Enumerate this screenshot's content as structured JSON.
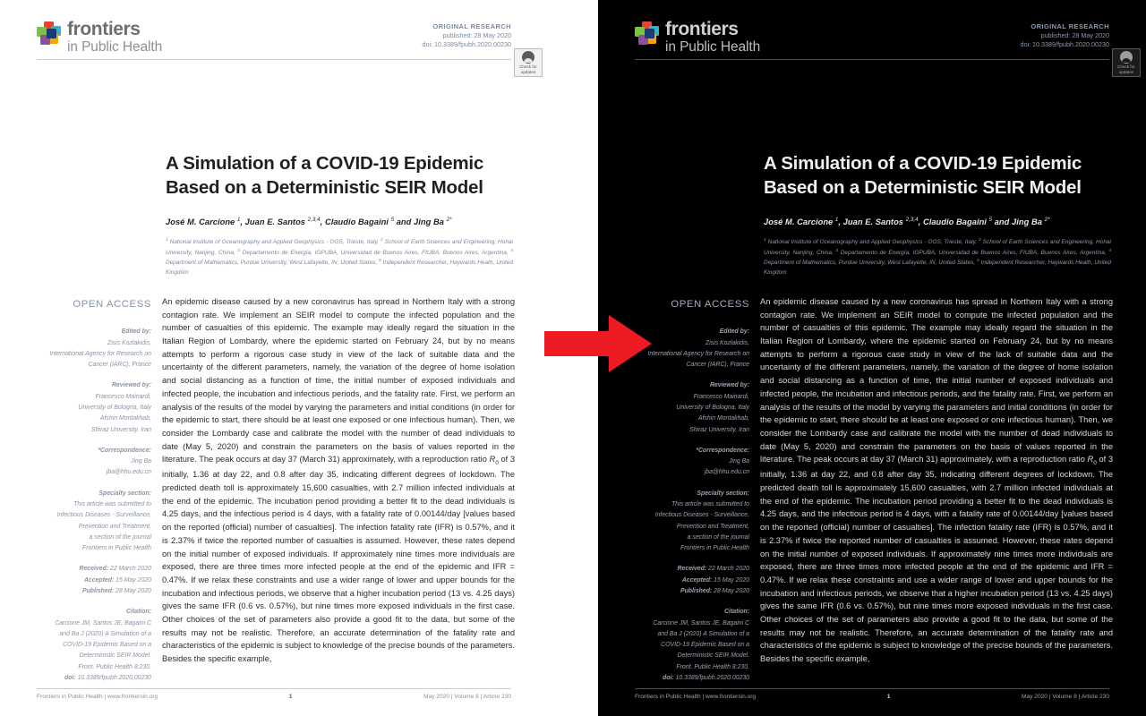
{
  "journal": {
    "logo_word": "frontiers",
    "logo_sub": "in Public Health",
    "logo_icon": "frontiers-pinwheel-logo"
  },
  "publication": {
    "type": "ORIGINAL RESEARCH",
    "published": "published: 28 May 2020",
    "doi": "doi: 10.3389/fpubh.2020.00230"
  },
  "crossmark": {
    "line1": "Check for",
    "line2": "updates",
    "icon": "check-for-updates-icon"
  },
  "paper": {
    "title_line1": "A Simulation of a COVID-19 Epidemic",
    "title_line2": "Based on a Deterministic SEIR Model",
    "authors_html": "José M. Carcione <sup>1</sup>, Juan E. Santos <sup>2,3,4</sup>, Claudio Bagaini <sup>5</sup> and Jing Ba <sup>2*</sup>",
    "affiliations_html": "<sup>1</sup> National Institute of Oceanography and Applied Geophysics - OGS, Trieste, Italy, <sup>2</sup> School of Earth Sciences and Engineering, Hohai University, Nanjing, China, <sup>3</sup> Departamento de Energía, IGPUBA, Universidad de Buenos Aires, FIUBA, Buenos Aires, Argentina, <sup>4</sup> Department of Mathematics, Purdue University, West Lafayette, IN, United States, <sup>5</sup> Independent Researcher, Haywards Heath, United Kingdom"
  },
  "sidebar": {
    "open_access": "OPEN ACCESS",
    "groups": [
      {
        "head": "Edited by:",
        "lines": [
          "Zisis Kozlakidis,",
          "International Agency for Research on",
          "Cancer (IARC), France"
        ]
      },
      {
        "head": "Reviewed by:",
        "lines": [
          "Francesco Mainardi,",
          "University of Bologna, Italy",
          "Afshin Montakhab,",
          "Shiraz University, Iran"
        ]
      },
      {
        "head": "*Correspondence:",
        "lines": [
          "Jing Ba",
          "jba@hhu.edu.cn"
        ]
      },
      {
        "head": "Specialty section:",
        "lines": [
          "This article was submitted to",
          "Infectious Diseases - Surveillance,",
          "Prevention and Treatment,",
          "a section of the journal",
          "Frontiers in Public Health"
        ]
      }
    ],
    "dates": [
      "Received: 22 March 2020",
      "Accepted: 15 May 2020",
      "Published: 28 May 2020"
    ],
    "citation_head": "Citation:",
    "citation_lines": [
      "Carcione JM, Santos JE, Bagaini C",
      "and Ba J (2020) A Simulation of a",
      "COVID-19 Epidemic Based on a",
      "Deterministic SEIR Model.",
      "Front. Public Health 8:230.",
      "doi: 10.3389/fpubh.2020.00230"
    ]
  },
  "abstract": {
    "text_html": "An epidemic disease caused by a new coronavirus has spread in Northern Italy with a strong contagion rate. We implement an SEIR model to compute the infected population and the number of casualties of this epidemic. The example may ideally regard the situation in the Italian Region of Lombardy, where the epidemic started on February 24, but by no means attempts to perform a rigorous case study in view of the lack of suitable data and the uncertainty of the different parameters, namely, the variation of the degree of home isolation and social distancing as a function of time, the initial number of exposed individuals and infected people, the incubation and infectious periods, and the fatality rate. First, we perform an analysis of the results of the model by varying the parameters and initial conditions (in order for the epidemic to start, there should be at least one exposed or one infectious human). Then, we consider the Lombardy case and calibrate the model with the number of dead individuals to date (May 5, 2020) and constrain the parameters on the basis of values reported in the literature. The peak occurs at day 37 (March 31) approximately, with a reproduction ratio <i>R</i><sub>0</sub> of 3 initially, 1.36 at day 22, and 0.8 after day 35, indicating different degrees of lockdown. The predicted death toll is approximately 15,600 casualties, with 2.7 million infected individuals at the end of the epidemic. The incubation period providing a better fit to the dead individuals is 4.25 days, and the infectious period is 4 days, with a fatality rate of 0.00144/day [values based on the reported (official) number of casualties]. The infection fatality rate (IFR) is 0.57%, and it is 2.37% if twice the reported number of casualties is assumed. However, these rates depend on the initial number of exposed individuals. If approximately nine times more individuals are exposed, there are three times more infected people at the end of the epidemic and IFR = 0.47%. If we relax these constraints and use a wider range of lower and upper bounds for the incubation and infectious periods, we observe that a higher incubation period (13 vs. 4.25 days) gives the same IFR (0.6 vs. 0.57%), but nine times more exposed individuals in the first case. Other choices of the set of parameters also provide a good fit to the data, but some of the results may not be realistic. Therefore, an accurate determination of the fatality rate and characteristics of the epidemic is subject to knowledge of the precise bounds of the parameters. Besides the specific example,"
  },
  "footer": {
    "left": "Frontiers in Public Health | www.frontiersin.org",
    "center": "1",
    "right": "May 2020 | Volume 8 | Article 230"
  },
  "arrow": {
    "name": "red-right-arrow",
    "color": "#ee1b24"
  }
}
